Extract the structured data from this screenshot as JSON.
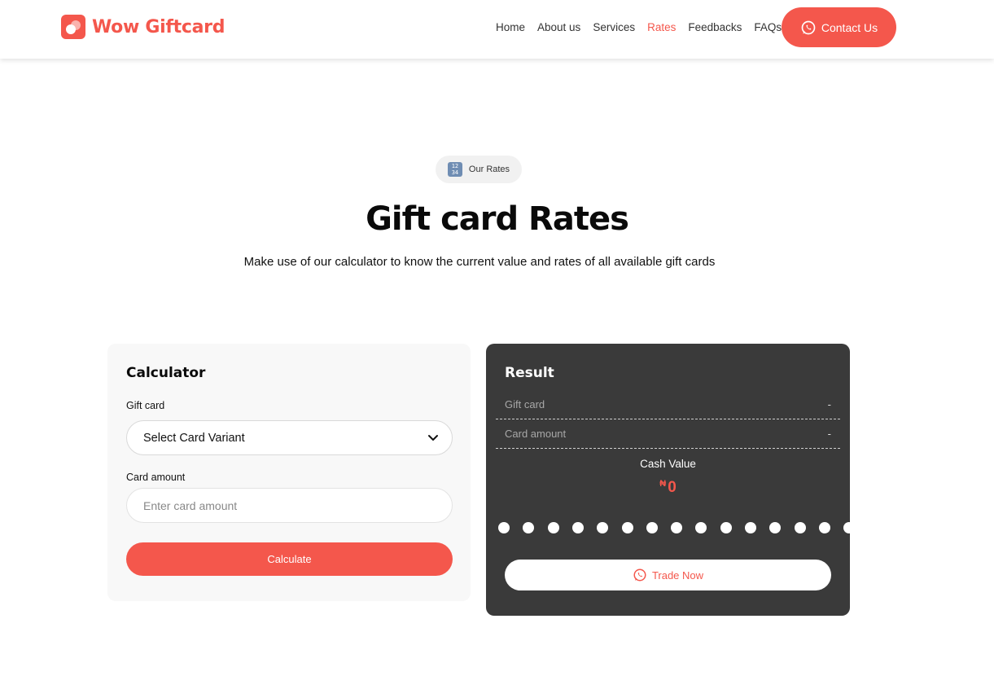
{
  "header": {
    "logo_text": "Wow Giftcard",
    "nav": [
      {
        "label": "Home",
        "active": false
      },
      {
        "label": "About us",
        "active": false
      },
      {
        "label": "Services",
        "active": false
      },
      {
        "label": "Rates",
        "active": true
      },
      {
        "label": "Feedbacks",
        "active": false
      },
      {
        "label": "FAQs",
        "active": false
      }
    ],
    "contact_label": "Contact Us"
  },
  "hero": {
    "pill_icon_text": "1234",
    "pill_label": "Our Rates",
    "title": "Gift card Rates",
    "subtitle": "Make use of our calculator to know the current value and rates of all available gift cards"
  },
  "calculator": {
    "title": "Calculator",
    "gift_card_label": "Gift card",
    "gift_card_selected": "Select Card Variant",
    "card_amount_label": "Card amount",
    "card_amount_placeholder": "Enter card amount",
    "calculate_label": "Calculate"
  },
  "result": {
    "title": "Result",
    "rows": [
      {
        "label": "Gift card",
        "value": "-"
      },
      {
        "label": "Card amount",
        "value": "-"
      }
    ],
    "cash_label": "Cash Value",
    "currency_symbol": "₦",
    "cash_value": "0",
    "trade_label": "Trade Now"
  },
  "colors": {
    "accent": "#f4574c",
    "result_bg": "#3a3a3a",
    "calculator_bg": "#f8f8f8"
  },
  "icons": {
    "logo": "logo-icon",
    "contact": "whatsapp-icon",
    "pill": "input-numbers-icon",
    "select": "chevron-down-icon",
    "trade": "whatsapp-icon"
  }
}
